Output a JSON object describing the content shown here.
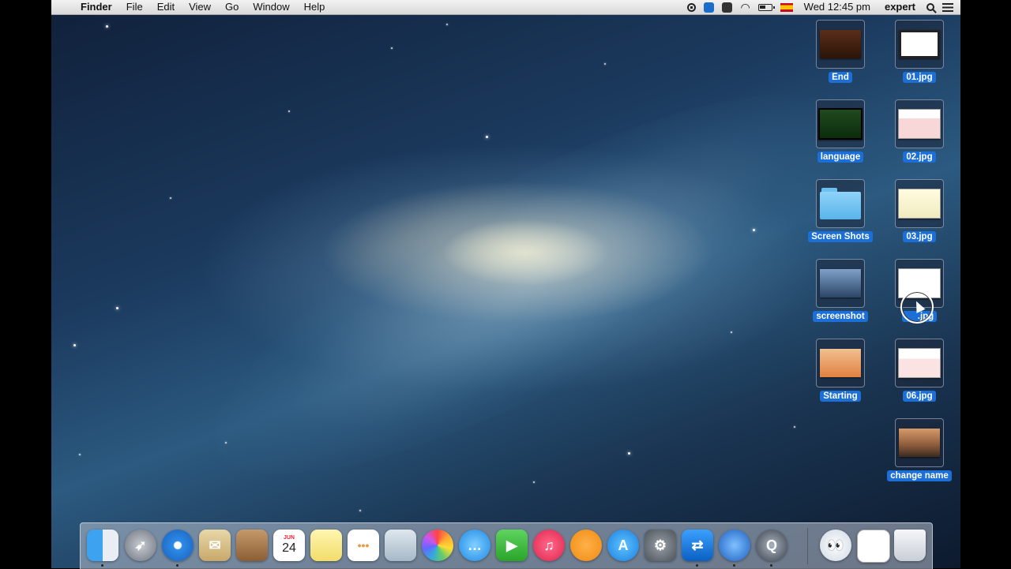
{
  "menubar": {
    "apple_icon": "apple-logo-icon",
    "app_name": "Finder",
    "menus": [
      "File",
      "Edit",
      "View",
      "Go",
      "Window",
      "Help"
    ],
    "status_icons": [
      "record-icon",
      "teamviewer-icon",
      "b-app-icon",
      "wifi-icon",
      "battery-icon",
      "spain-flag-icon"
    ],
    "clock": "Wed 12:45 pm",
    "user": "expert",
    "search_icon": "spotlight-search-icon",
    "notification_icon": "notification-center-icon"
  },
  "desktop_icons": {
    "left_column": [
      {
        "label": "End"
      },
      {
        "label": "language"
      },
      {
        "label": "Screen Shots"
      },
      {
        "label": "screenshot"
      },
      {
        "label": "Starting"
      }
    ],
    "right_column": [
      {
        "label": "01.jpg"
      },
      {
        "label": "02.jpg"
      },
      {
        "label": "03.jpg"
      },
      {
        "label": ".jpg"
      },
      {
        "label": "06.jpg"
      },
      {
        "label": "change name"
      }
    ]
  },
  "dock": {
    "apps": [
      "Finder",
      "Launchpad",
      "Safari",
      "Mail",
      "Contacts",
      "Calendar",
      "Notes",
      "Reminders",
      "Preview",
      "Photos",
      "Messages",
      "FaceTime",
      "iTunes",
      "iBooks",
      "App Store",
      "System Preferences",
      "TeamViewer",
      "OpenOffice",
      "QuickTime Player",
      "Finder Folder",
      "Downloads",
      "Trash"
    ],
    "calendar_month": "JUN",
    "calendar_day": "24"
  },
  "colors": {
    "selection_label": "#1c6fd6",
    "menubar": "#e6e6e6"
  }
}
